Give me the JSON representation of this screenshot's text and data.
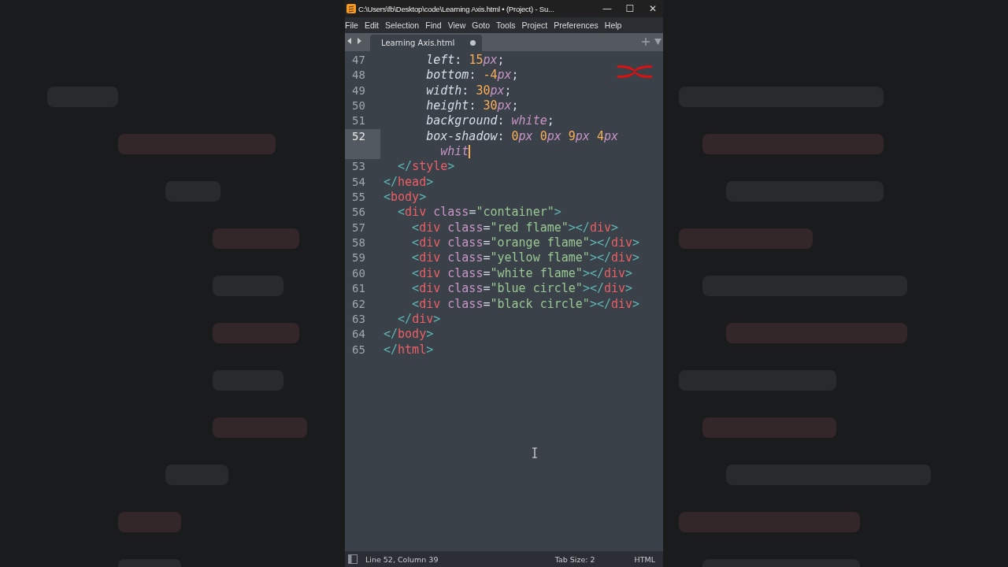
{
  "window": {
    "title": "C:\\Users\\fb\\Desktop\\code\\Learning Axis.html • (Project) - Su...",
    "controls": [
      "—",
      "☐",
      "✕"
    ]
  },
  "menu": [
    "File",
    "Edit",
    "Selection",
    "Find",
    "View",
    "Goto",
    "Tools",
    "Project",
    "Preferences",
    "Help"
  ],
  "tabs": [
    {
      "label": "Learning Axis.html",
      "selected": true,
      "modified": true
    }
  ],
  "editor": {
    "lines": [
      {
        "number": "47",
        "current": false,
        "tokens": [
          {
            "kind": "prop",
            "text": "      left"
          },
          {
            "kind": "plain",
            "text": ": "
          },
          {
            "kind": "num",
            "text": "15"
          },
          {
            "kind": "unit",
            "text": "px"
          },
          {
            "kind": "plain",
            "text": ";"
          }
        ]
      },
      {
        "number": "48",
        "current": false,
        "tokens": [
          {
            "kind": "prop",
            "text": "      bottom"
          },
          {
            "kind": "plain",
            "text": ": "
          },
          {
            "kind": "num",
            "text": "-4"
          },
          {
            "kind": "unit",
            "text": "px"
          },
          {
            "kind": "plain",
            "text": ";"
          }
        ]
      },
      {
        "number": "49",
        "current": false,
        "tokens": [
          {
            "kind": "prop",
            "text": "      width"
          },
          {
            "kind": "plain",
            "text": ": "
          },
          {
            "kind": "num",
            "text": "30"
          },
          {
            "kind": "unit",
            "text": "px"
          },
          {
            "kind": "plain",
            "text": ";"
          }
        ]
      },
      {
        "number": "50",
        "current": false,
        "tokens": [
          {
            "kind": "prop",
            "text": "      height"
          },
          {
            "kind": "plain",
            "text": ": "
          },
          {
            "kind": "num",
            "text": "30"
          },
          {
            "kind": "unit",
            "text": "px"
          },
          {
            "kind": "plain",
            "text": ";"
          }
        ]
      },
      {
        "number": "51",
        "current": false,
        "tokens": [
          {
            "kind": "prop",
            "text": "      background"
          },
          {
            "kind": "plain",
            "text": ": "
          },
          {
            "kind": "unit",
            "text": "white"
          },
          {
            "kind": "plain",
            "text": ";"
          }
        ]
      },
      {
        "number": "52",
        "current": true,
        "tokens": [
          {
            "kind": "prop",
            "text": "      box-shadow"
          },
          {
            "kind": "plain",
            "text": ": "
          },
          {
            "kind": "num",
            "text": "0"
          },
          {
            "kind": "unit",
            "text": "px"
          },
          {
            "kind": "num",
            "text": " 0"
          },
          {
            "kind": "unit",
            "text": "px"
          },
          {
            "kind": "num",
            "text": " 9"
          },
          {
            "kind": "unit",
            "text": "px"
          },
          {
            "kind": "num",
            "text": " 4"
          },
          {
            "kind": "unit",
            "text": "px"
          }
        ],
        "wrap": [
          {
            "kind": "unit",
            "text": "        whit"
          }
        ]
      },
      {
        "number": "53",
        "current": false,
        "tokens": [
          {
            "kind": "bracket",
            "text": "  </"
          },
          {
            "kind": "tag",
            "text": "style"
          },
          {
            "kind": "bracket",
            "text": ">"
          }
        ]
      },
      {
        "number": "54",
        "current": false,
        "tokens": [
          {
            "kind": "bracket",
            "text": "</"
          },
          {
            "kind": "tag",
            "text": "head"
          },
          {
            "kind": "bracket",
            "text": ">"
          }
        ]
      },
      {
        "number": "55",
        "current": false,
        "tokens": [
          {
            "kind": "bracket",
            "text": "<"
          },
          {
            "kind": "tag",
            "text": "body"
          },
          {
            "kind": "bracket",
            "text": ">"
          }
        ]
      },
      {
        "number": "56",
        "current": false,
        "tokens": [
          {
            "kind": "bracket",
            "text": "  <"
          },
          {
            "kind": "tag",
            "text": "div"
          },
          {
            "kind": "attr",
            "text": " class"
          },
          {
            "kind": "plain",
            "text": "="
          },
          {
            "kind": "string",
            "text": "\"container\""
          },
          {
            "kind": "bracket",
            "text": ">"
          }
        ]
      },
      {
        "number": "57",
        "current": false,
        "tokens": [
          {
            "kind": "bracket",
            "text": "    <"
          },
          {
            "kind": "tag",
            "text": "div"
          },
          {
            "kind": "attr",
            "text": " class"
          },
          {
            "kind": "plain",
            "text": "="
          },
          {
            "kind": "string",
            "text": "\"red flame\""
          },
          {
            "kind": "bracket",
            "text": "></"
          },
          {
            "kind": "tag",
            "text": "div"
          },
          {
            "kind": "bracket",
            "text": ">"
          }
        ]
      },
      {
        "number": "58",
        "current": false,
        "tokens": [
          {
            "kind": "bracket",
            "text": "    <"
          },
          {
            "kind": "tag",
            "text": "div"
          },
          {
            "kind": "attr",
            "text": " class"
          },
          {
            "kind": "plain",
            "text": "="
          },
          {
            "kind": "string",
            "text": "\"orange flame\""
          },
          {
            "kind": "bracket",
            "text": "></"
          },
          {
            "kind": "tag",
            "text": "div"
          },
          {
            "kind": "bracket",
            "text": ">"
          }
        ]
      },
      {
        "number": "59",
        "current": false,
        "tokens": [
          {
            "kind": "bracket",
            "text": "    <"
          },
          {
            "kind": "tag",
            "text": "div"
          },
          {
            "kind": "attr",
            "text": " class"
          },
          {
            "kind": "plain",
            "text": "="
          },
          {
            "kind": "string",
            "text": "\"yellow flame\""
          },
          {
            "kind": "bracket",
            "text": "></"
          },
          {
            "kind": "tag",
            "text": "div"
          },
          {
            "kind": "bracket",
            "text": ">"
          }
        ]
      },
      {
        "number": "60",
        "current": false,
        "tokens": [
          {
            "kind": "bracket",
            "text": "    <"
          },
          {
            "kind": "tag",
            "text": "div"
          },
          {
            "kind": "attr",
            "text": " class"
          },
          {
            "kind": "plain",
            "text": "="
          },
          {
            "kind": "string",
            "text": "\"white flame\""
          },
          {
            "kind": "bracket",
            "text": "></"
          },
          {
            "kind": "tag",
            "text": "div"
          },
          {
            "kind": "bracket",
            "text": ">"
          }
        ]
      },
      {
        "number": "61",
        "current": false,
        "tokens": [
          {
            "kind": "bracket",
            "text": "    <"
          },
          {
            "kind": "tag",
            "text": "div"
          },
          {
            "kind": "attr",
            "text": " class"
          },
          {
            "kind": "plain",
            "text": "="
          },
          {
            "kind": "string",
            "text": "\"blue circle\""
          },
          {
            "kind": "bracket",
            "text": "></"
          },
          {
            "kind": "tag",
            "text": "div"
          },
          {
            "kind": "bracket",
            "text": ">"
          }
        ]
      },
      {
        "number": "62",
        "current": false,
        "tokens": [
          {
            "kind": "bracket",
            "text": "    <"
          },
          {
            "kind": "tag",
            "text": "div"
          },
          {
            "kind": "attr",
            "text": " class"
          },
          {
            "kind": "plain",
            "text": "="
          },
          {
            "kind": "string",
            "text": "\"black circle\""
          },
          {
            "kind": "bracket",
            "text": "></"
          },
          {
            "kind": "tag",
            "text": "div"
          },
          {
            "kind": "bracket",
            "text": ">"
          }
        ]
      },
      {
        "number": "63",
        "current": false,
        "tokens": [
          {
            "kind": "bracket",
            "text": "  </"
          },
          {
            "kind": "tag",
            "text": "div"
          },
          {
            "kind": "bracket",
            "text": ">"
          }
        ]
      },
      {
        "number": "64",
        "current": false,
        "tokens": [
          {
            "kind": "bracket",
            "text": "</"
          },
          {
            "kind": "tag",
            "text": "body"
          },
          {
            "kind": "bracket",
            "text": ">"
          }
        ]
      },
      {
        "number": "65",
        "current": false,
        "tokens": [
          {
            "kind": "bracket",
            "text": "</"
          },
          {
            "kind": "tag",
            "text": "html"
          },
          {
            "kind": "bracket",
            "text": ">"
          }
        ]
      }
    ]
  },
  "status_bar": {
    "position": "Line 52, Column 39",
    "tab_size": "Tab Size: 2",
    "syntax": "HTML"
  }
}
